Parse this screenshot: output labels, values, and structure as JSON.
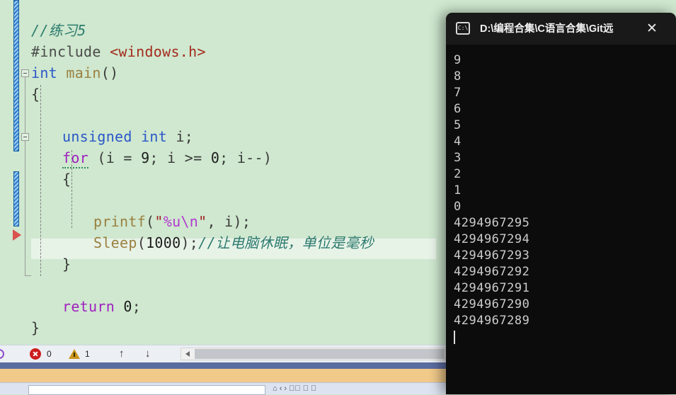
{
  "editor": {
    "background_color": "#cfe8cf",
    "current_line_marker": "execution-pointer",
    "lines": [
      {
        "indent": 0,
        "tokens": [
          {
            "cls": "c-cmt",
            "t": "//练习5"
          }
        ]
      },
      {
        "indent": 0,
        "tokens": [
          {
            "cls": "c-pre",
            "t": "#include "
          },
          {
            "cls": "c-inc",
            "t": "<windows.h>"
          }
        ]
      },
      {
        "indent": 0,
        "tokens": [
          {
            "cls": "c-kw",
            "t": "int "
          },
          {
            "cls": "c-fn",
            "t": "main"
          },
          {
            "cls": "c-plain",
            "t": "()"
          }
        ]
      },
      {
        "indent": 0,
        "tokens": [
          {
            "cls": "c-plain",
            "t": "{"
          }
        ]
      },
      {
        "indent": 0,
        "tokens": []
      },
      {
        "indent": 1,
        "tokens": [
          {
            "cls": "c-kw",
            "t": "unsigned int "
          },
          {
            "cls": "c-plain",
            "t": "i;"
          }
        ]
      },
      {
        "indent": 1,
        "tokens": [
          {
            "cls": "c-ctl squiggle",
            "t": "for"
          },
          {
            "cls": "c-plain",
            "t": " (i = "
          },
          {
            "cls": "c-num",
            "t": "9"
          },
          {
            "cls": "c-plain",
            "t": "; i >= "
          },
          {
            "cls": "c-num",
            "t": "0"
          },
          {
            "cls": "c-plain",
            "t": "; i--)"
          }
        ]
      },
      {
        "indent": 1,
        "tokens": [
          {
            "cls": "c-plain",
            "t": "{"
          }
        ]
      },
      {
        "indent": 1,
        "tokens": []
      },
      {
        "indent": 2,
        "tokens": [
          {
            "cls": "c-fn",
            "t": "printf"
          },
          {
            "cls": "c-plain",
            "t": "("
          },
          {
            "cls": "c-str",
            "t": "\""
          },
          {
            "cls": "c-esc",
            "t": "%u"
          },
          {
            "cls": "c-esc",
            "t": "\\n"
          },
          {
            "cls": "c-str",
            "t": "\""
          },
          {
            "cls": "c-plain",
            "t": ", i);"
          }
        ]
      },
      {
        "indent": 2,
        "tokens": [
          {
            "cls": "c-fn",
            "t": "Sleep"
          },
          {
            "cls": "c-plain",
            "t": "("
          },
          {
            "cls": "c-num",
            "t": "1000"
          },
          {
            "cls": "c-plain",
            "t": ");"
          },
          {
            "cls": "c-cmt",
            "t": "//让电脑休眠，单位是毫秒"
          }
        ]
      },
      {
        "indent": 1,
        "tokens": [
          {
            "cls": "c-plain",
            "t": "}"
          }
        ]
      },
      {
        "indent": 1,
        "tokens": []
      },
      {
        "indent": 1,
        "tokens": [
          {
            "cls": "c-ctl",
            "t": "return "
          },
          {
            "cls": "c-num",
            "t": "0"
          },
          {
            "cls": "c-plain",
            "t": ";"
          }
        ]
      },
      {
        "indent": 0,
        "tokens": [
          {
            "cls": "c-plain",
            "t": "}"
          }
        ]
      }
    ]
  },
  "statusbar": {
    "error_icon": "error-circle-icon",
    "error_count": "0",
    "warning_icon": "warning-triangle-icon",
    "warning_count": "1",
    "prev_icon": "↑",
    "next_icon": "↓",
    "scroll_left_icon": "scroll-left-arrow-icon"
  },
  "bottom_panel": {
    "tools": "⌂  ‹  ›  ✕⃒  ＋  ⌾"
  },
  "console": {
    "icon": "C:\\",
    "title": "D:\\编程合集\\C语言合集\\Git远",
    "close_label": "✕",
    "background_color": "#0c0c0c",
    "text_color": "#cccccc",
    "output": [
      "9",
      "8",
      "7",
      "6",
      "5",
      "4",
      "3",
      "2",
      "1",
      "0",
      "4294967295",
      "4294967294",
      "4294967293",
      "4294967292",
      "4294967291",
      "4294967290",
      "4294967289"
    ],
    "cursor_visible": true
  }
}
